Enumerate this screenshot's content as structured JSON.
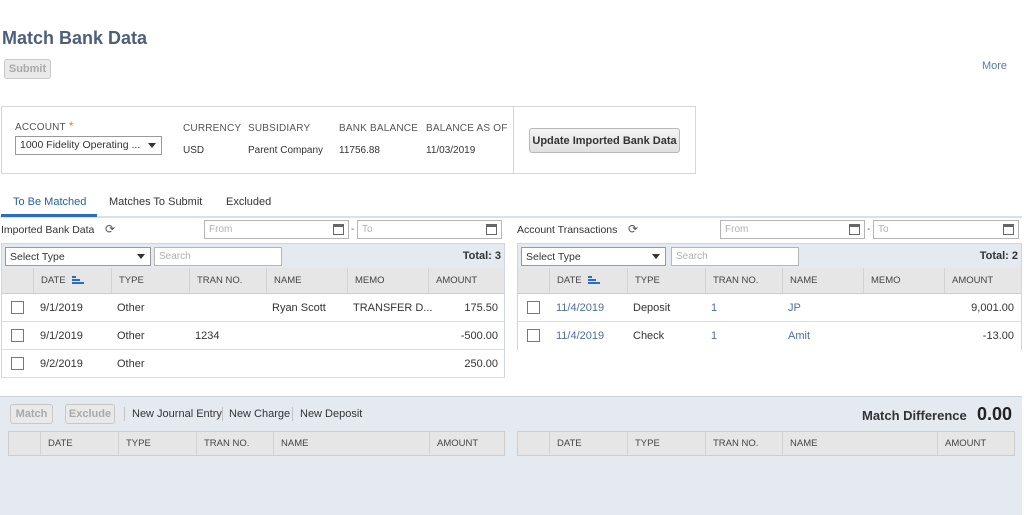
{
  "page": {
    "title": "Match Bank Data",
    "submit_label": "Submit",
    "more_label": "More"
  },
  "account": {
    "label": "ACCOUNT",
    "required_mark": "*",
    "value": "1000 Fidelity Operating ...",
    "currency_label": "CURRENCY",
    "currency": "USD",
    "subsidiary_label": "SUBSIDIARY",
    "subsidiary": "Parent Company",
    "bank_balance_label": "BANK BALANCE",
    "bank_balance": "11756.88",
    "balance_as_of_label": "BALANCE AS OF",
    "balance_as_of": "11/03/2019",
    "update_label": "Update Imported Bank Data"
  },
  "tabs": [
    {
      "label": "To Be Matched",
      "active": true
    },
    {
      "label": "Matches To Submit",
      "active": false
    },
    {
      "label": "Excluded",
      "active": false
    }
  ],
  "imported": {
    "title": "Imported Bank Data",
    "from_placeholder": "From",
    "to_placeholder": "To",
    "select_type": "Select Type",
    "search_placeholder": "Search",
    "total": "Total: 3",
    "columns": [
      "DATE",
      "TYPE",
      "TRAN NO.",
      "NAME",
      "MEMO",
      "AMOUNT"
    ],
    "rows": [
      {
        "date": "9/1/2019",
        "type": "Other",
        "tran": "",
        "name": "Ryan Scott",
        "memo": "TRANSFER D...",
        "amount": "175.50"
      },
      {
        "date": "9/1/2019",
        "type": "Other",
        "tran": "1234",
        "name": "",
        "memo": "",
        "amount": "-500.00"
      },
      {
        "date": "9/2/2019",
        "type": "Other",
        "tran": "",
        "name": "",
        "memo": "",
        "amount": "250.00"
      }
    ]
  },
  "transactions": {
    "title": "Account Transactions",
    "from_placeholder": "From",
    "to_placeholder": "To",
    "select_type": "Select Type",
    "search_placeholder": "Search",
    "total": "Total: 2",
    "columns": [
      "DATE",
      "TYPE",
      "TRAN NO.",
      "NAME",
      "MEMO",
      "AMOUNT"
    ],
    "rows": [
      {
        "date": "11/4/2019",
        "type": "Deposit",
        "tran": "1",
        "name": "JP",
        "memo": "",
        "amount": "9,001.00"
      },
      {
        "date": "11/4/2019",
        "type": "Check",
        "tran": "1",
        "name": "Amit",
        "memo": "",
        "amount": "-13.00"
      }
    ]
  },
  "bottom": {
    "match_label": "Match",
    "exclude_label": "Exclude",
    "new_journal": "New Journal Entry",
    "new_charge": "New Charge",
    "new_deposit": "New Deposit",
    "match_difference_label": "Match Difference",
    "match_difference_value": "0.00",
    "left_columns": [
      "DATE",
      "TYPE",
      "TRAN NO.",
      "NAME",
      "AMOUNT"
    ],
    "right_columns": [
      "DATE",
      "TYPE",
      "TRAN NO.",
      "NAME",
      "AMOUNT"
    ]
  },
  "colors": {
    "accent": "#2a6ebf",
    "link": "#4f6f98",
    "panel_bg": "#e5eaf0",
    "title": "#4d5f79"
  }
}
